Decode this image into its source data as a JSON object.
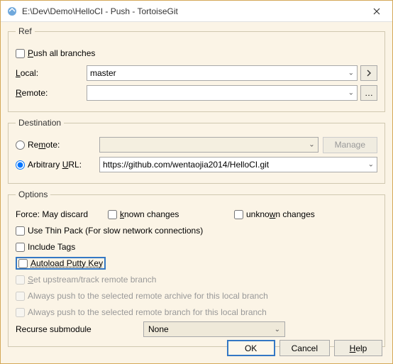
{
  "titlebar": {
    "text": "E:\\Dev\\Demo\\HelloCI - Push - TortoiseGit"
  },
  "ref": {
    "legend": "Ref",
    "push_all": "Push all branches",
    "local_label": "Local:",
    "local_value": "master",
    "remote_label": "Remote:",
    "remote_value": ""
  },
  "dest": {
    "legend": "Destination",
    "remote_label": "Remote:",
    "remote_value": "",
    "manage": "Manage",
    "arb_label": "Arbitrary URL:",
    "arb_value": "https://github.com/wentaojia2014/HelloCI.git"
  },
  "opts": {
    "legend": "Options",
    "force_label": "Force: May discard",
    "known": "known changes",
    "unknown": "unknown changes",
    "thin": "Use Thin Pack (For slow network connections)",
    "tags": "Include Tags",
    "putty": "Autoload Putty Key",
    "upstream": "Set upstream/track remote branch",
    "archive": "Always push to the selected remote archive for this local branch",
    "branch": "Always push to the selected remote branch for this local branch",
    "recurse_label": "Recurse submodule",
    "recurse_value": "None"
  },
  "buttons": {
    "ok": "OK",
    "cancel": "Cancel",
    "help": "Help"
  }
}
